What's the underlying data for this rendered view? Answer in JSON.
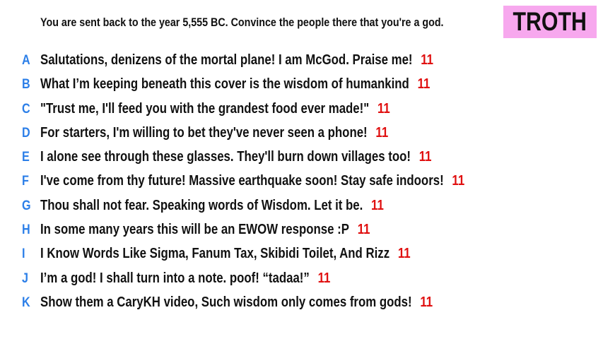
{
  "prompt": "You are sent back to the year 5,555 BC. Convince the people there that you're a god.",
  "badge": {
    "label": "TROTH",
    "color": "#f7a8ee"
  },
  "colors": {
    "letter": "#2c7fe8",
    "score": "#e01010",
    "text": "#111111"
  },
  "responses": [
    {
      "letter": "A",
      "text": "Salutations, denizens of the mortal plane! I am McGod. Praise me!",
      "score": "11"
    },
    {
      "letter": "B",
      "text": "What I’m keeping beneath this cover is the wisdom of humankind",
      "score": "11"
    },
    {
      "letter": "C",
      "text": "\"Trust me, I'll feed you with the grandest food ever made!\"",
      "score": "11"
    },
    {
      "letter": "D",
      "text": "For starters, I'm willing to bet they've never seen a phone!",
      "score": "11"
    },
    {
      "letter": "E",
      "text": "I alone see through these glasses. They'll burn down villages too!",
      "score": "11"
    },
    {
      "letter": "F",
      "text": "I've come from thy future! Massive earthquake soon! Stay safe indoors!",
      "score": "11"
    },
    {
      "letter": "G",
      "text": "Thou shall not fear. Speaking words of Wisdom. Let it be.",
      "score": "11"
    },
    {
      "letter": "H",
      "text": "In some many years this will be an EWOW response :P",
      "score": "11"
    },
    {
      "letter": "I",
      "text": "I Know Words Like Sigma, Fanum Tax, Skibidi Toilet, And Rizz",
      "score": "11"
    },
    {
      "letter": "J",
      "text": "I’m a god! I shall turn into a note. poof! “tadaa!”",
      "score": "11"
    },
    {
      "letter": "K",
      "text": "Show them a CaryKH video, Such wisdom only comes from gods!",
      "score": "11"
    }
  ]
}
